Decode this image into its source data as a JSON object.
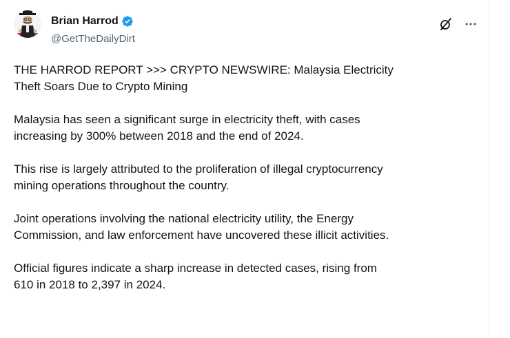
{
  "author": {
    "display_name": "Brian Harrod",
    "handle": "@GetTheDailyDirt",
    "verified": true,
    "verified_color": "#1d9bf0"
  },
  "icons": {
    "grok": "grok-slash-icon",
    "more": "more-options-icon"
  },
  "tweet": {
    "paragraphs": [
      "THE HARROD REPORT >>> CRYPTO NEWSWIRE: Malaysia Electricity\nTheft Soars Due to Crypto Mining",
      "Malaysia has seen a significant surge in electricity theft, with cases\nincreasing by 300% between 2018 and the end of 2024.",
      "This rise is largely attributed to the proliferation of illegal cryptocurrency\nmining operations throughout the country.",
      "Joint operations involving the national electricity utility, the Energy\nCommission, and law enforcement have uncovered these illicit activities.",
      "Official figures indicate a sharp increase in detected cases, rising from\n610 in 2018 to 2,397 in 2024."
    ]
  }
}
